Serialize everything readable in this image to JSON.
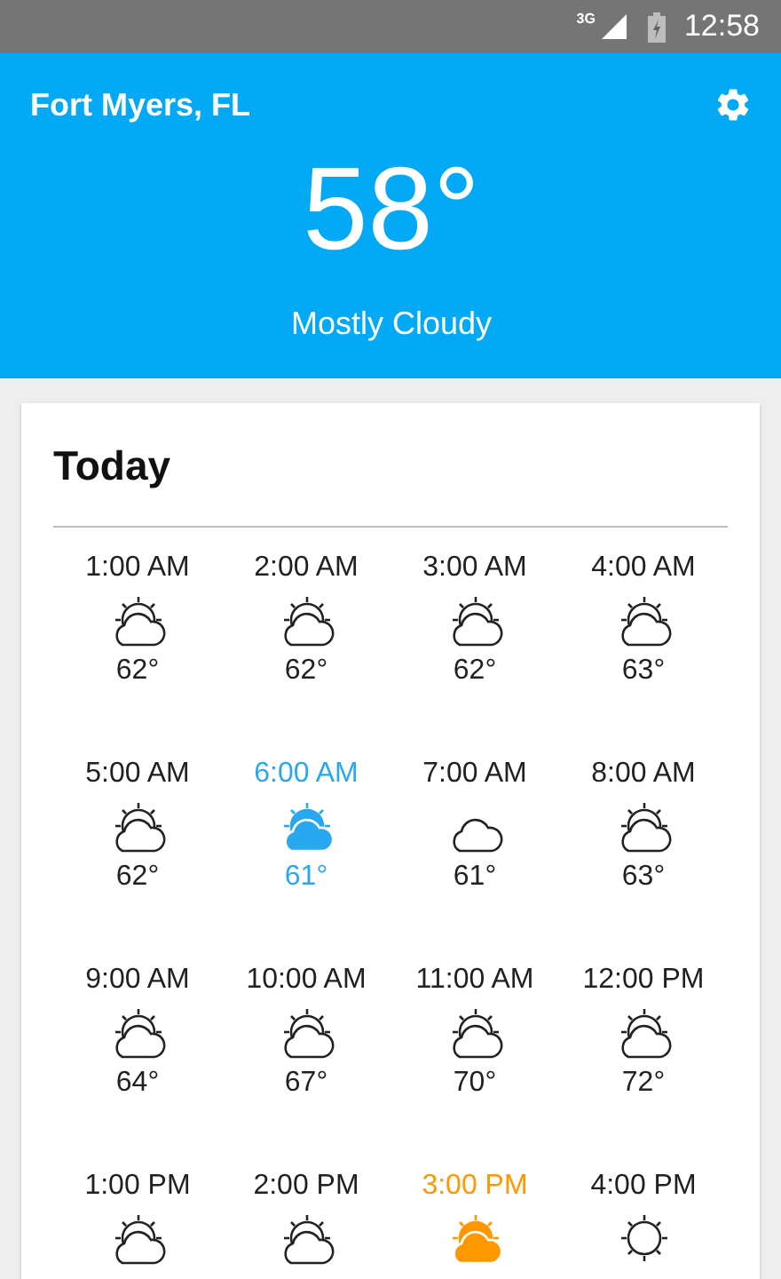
{
  "status_bar": {
    "network": "3G",
    "time": "12:58"
  },
  "header": {
    "location": "Fort Myers, FL",
    "temperature": "58°",
    "condition": "Mostly Cloudy"
  },
  "today": {
    "title": "Today",
    "hours": [
      {
        "time": "1:00 AM",
        "kind": "partly-cloudy",
        "temp": "62°",
        "highlighted": false,
        "color": "#212121"
      },
      {
        "time": "2:00 AM",
        "kind": "partly-cloudy",
        "temp": "62°",
        "highlighted": false,
        "color": "#212121"
      },
      {
        "time": "3:00 AM",
        "kind": "partly-cloudy",
        "temp": "62°",
        "highlighted": false,
        "color": "#212121"
      },
      {
        "time": "4:00 AM",
        "kind": "partly-cloudy",
        "temp": "63°",
        "highlighted": false,
        "color": "#212121"
      },
      {
        "time": "5:00 AM",
        "kind": "partly-cloudy",
        "temp": "62°",
        "highlighted": false,
        "color": "#212121"
      },
      {
        "time": "6:00 AM",
        "kind": "partly-cloudy",
        "temp": "61°",
        "highlighted": true,
        "color": "#29a8f0"
      },
      {
        "time": "7:00 AM",
        "kind": "cloudy",
        "temp": "61°",
        "highlighted": false,
        "color": "#212121"
      },
      {
        "time": "8:00 AM",
        "kind": "partly-cloudy",
        "temp": "63°",
        "highlighted": false,
        "color": "#212121"
      },
      {
        "time": "9:00 AM",
        "kind": "partly-cloudy",
        "temp": "64°",
        "highlighted": false,
        "color": "#212121"
      },
      {
        "time": "10:00 AM",
        "kind": "partly-cloudy",
        "temp": "67°",
        "highlighted": false,
        "color": "#212121"
      },
      {
        "time": "11:00 AM",
        "kind": "partly-cloudy",
        "temp": "70°",
        "highlighted": false,
        "color": "#212121"
      },
      {
        "time": "12:00 PM",
        "kind": "partly-cloudy",
        "temp": "72°",
        "highlighted": false,
        "color": "#212121"
      },
      {
        "time": "1:00 PM",
        "kind": "partly-cloudy",
        "highlighted": false,
        "color": "#212121"
      },
      {
        "time": "2:00 PM",
        "kind": "partly-cloudy",
        "highlighted": false,
        "color": "#212121"
      },
      {
        "time": "3:00 PM",
        "kind": "partly-cloudy",
        "highlighted": true,
        "color": "#ff9800"
      },
      {
        "time": "4:00 PM",
        "kind": "sunny",
        "highlighted": false,
        "color": "#212121"
      }
    ]
  }
}
